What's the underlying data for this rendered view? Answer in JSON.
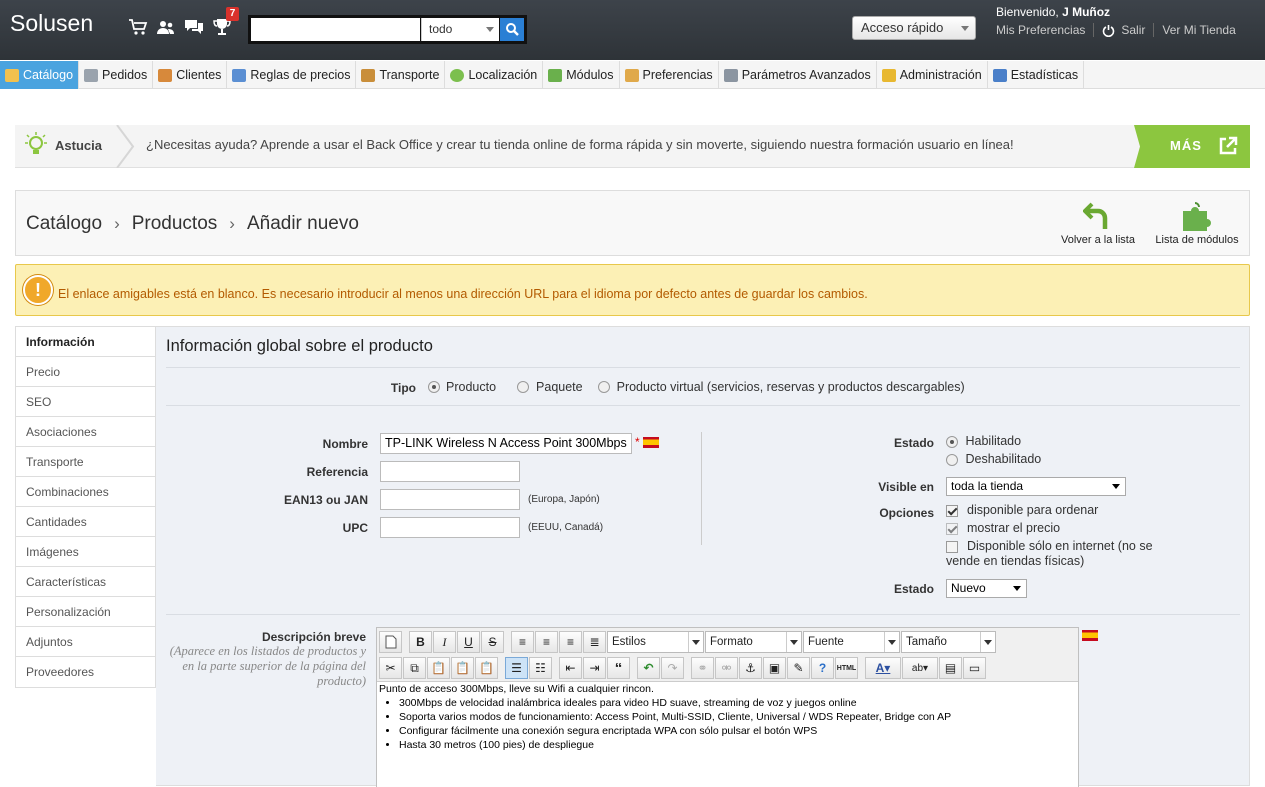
{
  "app": {
    "logo": "Solusen",
    "notification_count": "7"
  },
  "search": {
    "value": "",
    "scope": "todo"
  },
  "quick_access": {
    "label": "Acceso rápido"
  },
  "user": {
    "greeting": "Bienvenido,",
    "name": "J Muñoz",
    "preferences": "Mis Preferencias",
    "logout": "Salir",
    "view_store": "Ver Mi Tienda"
  },
  "menu": [
    {
      "label": "Catálogo",
      "color": "#f2c14e"
    },
    {
      "label": "Pedidos",
      "color": "#9aa3ad"
    },
    {
      "label": "Clientes",
      "color": "#d7893b"
    },
    {
      "label": "Reglas de precios",
      "color": "#5b8fd3"
    },
    {
      "label": "Transporte",
      "color": "#c98e3a"
    },
    {
      "label": "Localización",
      "color": "#7cbf4e"
    },
    {
      "label": "Módulos",
      "color": "#6ab04c"
    },
    {
      "label": "Preferencias",
      "color": "#e0a94a"
    },
    {
      "label": "Parámetros Avanzados",
      "color": "#8b95a1"
    },
    {
      "label": "Administración",
      "color": "#e8b830"
    },
    {
      "label": "Estadísticas",
      "color": "#4a7fc9"
    }
  ],
  "hint": {
    "label": "Astucia",
    "text": "¿Necesitas ayuda? Aprende a usar el Back Office y crear tu tienda online de forma rápida y sin moverte, siguiendo nuestra formación usuario en línea!",
    "more": "MÁS"
  },
  "breadcrumb": [
    "Catálogo",
    "Productos",
    "Añadir nuevo"
  ],
  "actions": {
    "back": "Volver a la lista",
    "modules": "Lista de módulos"
  },
  "warning": {
    "text": "El enlace amigables está en blanco. Es necesario introducir al menos una dirección URL para el idioma por defecto antes de guardar los cambios."
  },
  "tabs": [
    "Información",
    "Precio",
    "SEO",
    "Asociaciones",
    "Transporte",
    "Combinaciones",
    "Cantidades",
    "Imágenes",
    "Características",
    "Personalización",
    "Adjuntos",
    "Proveedores"
  ],
  "form": {
    "title": "Información global sobre el producto",
    "type_label": "Tipo",
    "types": [
      "Producto",
      "Paquete",
      "Producto virtual (servicios, reservas y productos descargables)"
    ],
    "name_label": "Nombre",
    "name_value": "TP-LINK Wireless N Access Point 300Mbps",
    "required": "*",
    "reference_label": "Referencia",
    "ean_label": "EAN13 ou JAN",
    "ean_hint": "(Europa, Japón)",
    "upc_label": "UPC",
    "upc_hint": "(EEUU, Canadá)",
    "status_label": "Estado",
    "status_enabled": "Habilitado",
    "status_disabled": "Deshabilitado",
    "visible_label": "Visible en",
    "visible_value": "toda la tienda",
    "options_label": "Opciones",
    "opt_order": "disponible para ordenar",
    "opt_price": "mostrar el precio",
    "opt_online": "Disponible sólo en internet (no se vende en tiendas físicas)",
    "condition_label": "Estado",
    "condition_value": "Nuevo",
    "short_desc_label": "Descripción breve",
    "short_desc_hint": "(Aparece en los listados de productos y en la parte superior de la página del producto)"
  },
  "editor": {
    "styles": "Estilos",
    "format": "Formato",
    "font": "Fuente",
    "size": "Tamaño",
    "intro": "Punto de acceso 300Mbps, lleve su Wifi a cualquier rincon.",
    "bullets": [
      "300Mbps de velocidad inalámbrica ideales para video HD suave, streaming de voz y juegos online",
      "Soporta varios modos de funcionamiento: Access Point, Multi-SSID, Cliente, Universal / WDS Repeater, Bridge con AP",
      "Configurar fácilmente una conexión segura encriptada WPA con sólo pulsar el botón WPS",
      "Hasta 30 metros (100 pies) de despliegue"
    ]
  }
}
